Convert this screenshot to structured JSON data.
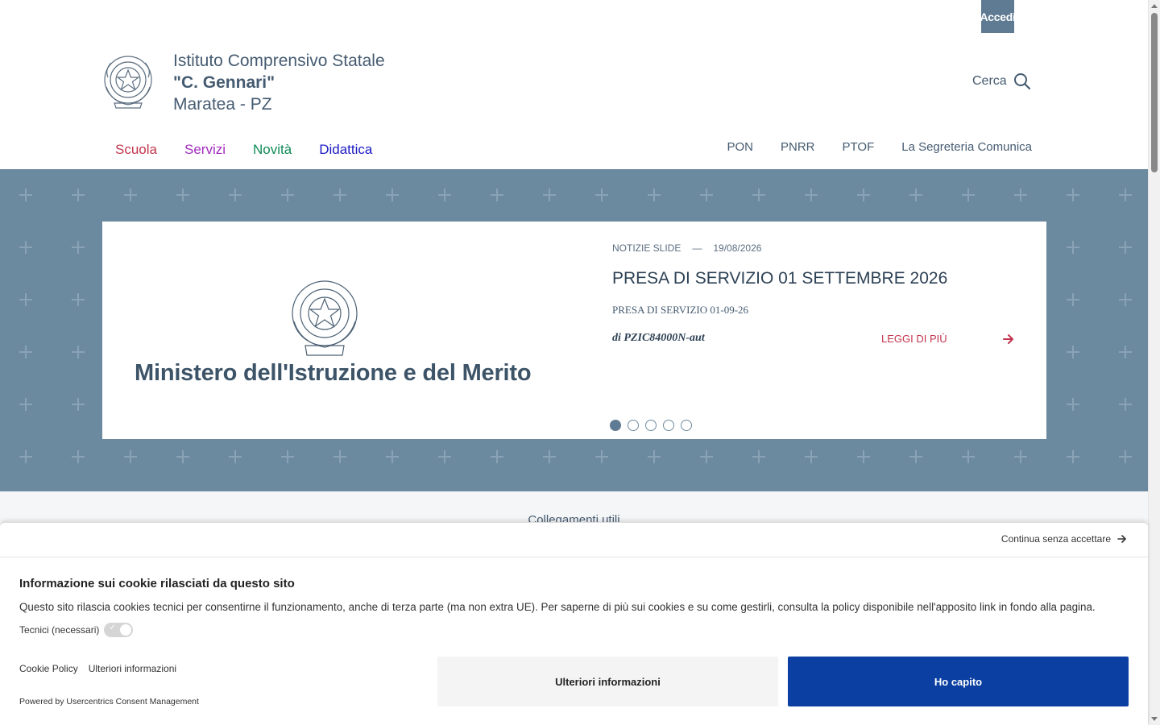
{
  "topbar": {
    "login_label": "Accedi"
  },
  "header": {
    "line1": "Istituto Comprensivo Statale",
    "line2": "\"C. Gennari\"",
    "line3": "Maratea - PZ",
    "search_label": "Cerca"
  },
  "nav": {
    "main": [
      {
        "label": "Scuola",
        "color": "#c2344d"
      },
      {
        "label": "Servizi",
        "color": "#a32cbf"
      },
      {
        "label": "Novità",
        "color": "#0f8a55"
      },
      {
        "label": "Didattica",
        "color": "#1a1ac4"
      }
    ],
    "secondary": [
      "PON",
      "PNRR",
      "PTOF",
      "La Segreteria Comunica"
    ]
  },
  "slide": {
    "logo_text": "Ministero dell'Istruzione e del Merito",
    "category": "NOTIZIE SLIDE",
    "separator": "—",
    "date": "19/08/2026",
    "title": "PRESA DI SERVIZIO 01 SETTEMBRE 2026",
    "subtitle": "PRESA DI SERVIZIO 01-09-26",
    "author": "di PZIC84000N-aut",
    "read_more": "LEGGI DI PIÙ",
    "dots_count": 5,
    "active_dot": 1
  },
  "links": {
    "title": "Collegamenti utili"
  },
  "cookie": {
    "continue_label": "Continua senza accettare",
    "title": "Informazione sui cookie rilasciati da questo sito",
    "text": "Questo sito rilascia cookies tecnici per consentirne il funzionamento, anche di terza parte (ma non extra UE). Per saperne di più sui cookies e su come gestirli, consulta la policy disponibile nell'apposito link in fondo alla pagina.",
    "toggle_label": "Tecnici (necessari)",
    "links": [
      "Cookie Policy",
      "Ulteriori informazioni"
    ],
    "powered_by": "Powered by Usercentrics Consent Management",
    "btn_more": "Ulteriori informazioni",
    "btn_ok": "Ho capito"
  },
  "colors": {
    "hero_bg": "#6b8aa0",
    "accent": "#5f7b93",
    "primary_button": "#0b3fa1",
    "read_more": "#c2344d"
  }
}
